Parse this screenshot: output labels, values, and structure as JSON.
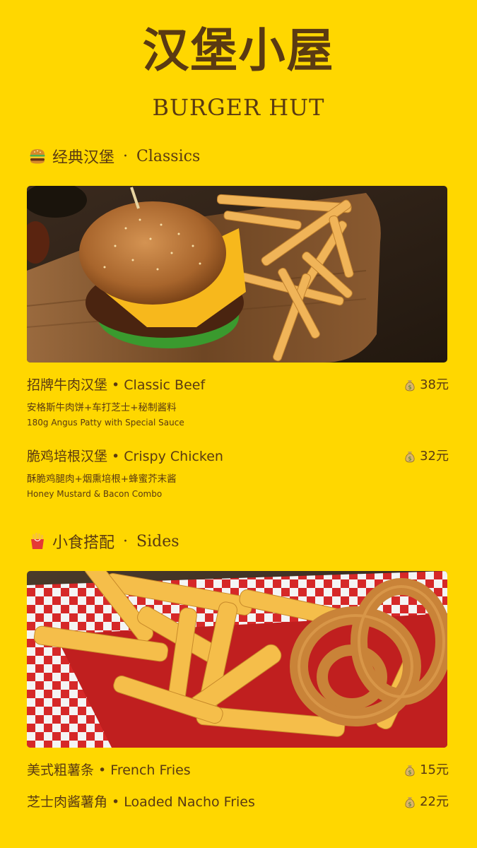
{
  "header": {
    "title_cn": "汉堡小屋",
    "title_en": "BURGER HUT"
  },
  "sections": [
    {
      "icon": "burger-emoji-icon",
      "title_cn": "经典汉堡",
      "separator": "·",
      "title_en": "Classics",
      "photo": "burger-and-fries-photo",
      "items": [
        {
          "name": "招牌牛肉汉堡 • Classic Beef",
          "price": "38元",
          "desc_cn": "安格斯牛肉饼+车打芝士+秘制酱料",
          "desc_en": "180g Angus Patty with Special Sauce"
        },
        {
          "name": "脆鸡培根汉堡 • Crispy Chicken",
          "price": "32元",
          "desc_cn": "酥脆鸡腿肉+烟熏培根+蜂蜜芥末酱",
          "desc_en": "Honey Mustard & Bacon Combo"
        }
      ]
    },
    {
      "icon": "fries-emoji-icon",
      "title_cn": "小食搭配",
      "separator": "·",
      "title_en": "Sides",
      "photo": "fries-and-onion-rings-photo",
      "items": [
        {
          "name": "美式粗薯条 • French Fries",
          "price": "15元"
        },
        {
          "name": "芝士肉酱薯角 • Loaded Nacho Fries",
          "price": "22元"
        }
      ]
    }
  ],
  "price_icon": "money-bag-icon",
  "colors": {
    "background": "#FFD700",
    "text": "#5a3a12"
  }
}
